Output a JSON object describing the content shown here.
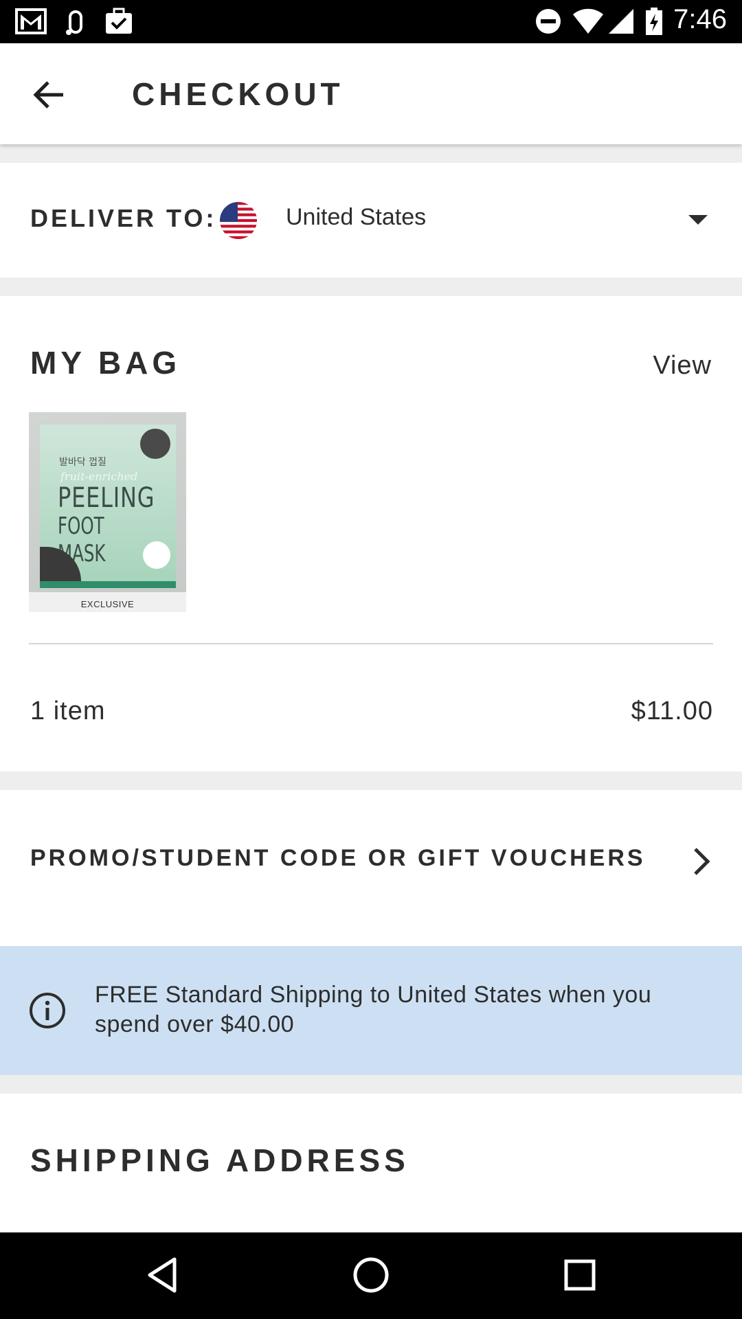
{
  "status_bar": {
    "time": "7:46",
    "left_icons": [
      "gmail-icon",
      "link-icon",
      "briefcase-check-icon"
    ],
    "right_icons": [
      "do-not-disturb-icon",
      "wifi-icon",
      "signal-icon",
      "battery-charging-icon"
    ]
  },
  "app_bar": {
    "title": "CHECKOUT",
    "back_icon": "arrow-back-icon"
  },
  "deliver_to": {
    "label": "DELIVER TO:",
    "country": "United States",
    "flag_icon": "us-flag-icon",
    "dropdown_icon": "caret-down-icon"
  },
  "bag": {
    "title": "MY BAG",
    "view_label": "View",
    "product": {
      "badge": "EXCLUSIVE",
      "packaging_line1": "PEELING",
      "packaging_line2": "FOOT MASK",
      "packaging_script": "fruit-enriched",
      "packaging_korean": "발바닥 껍질"
    },
    "item_count": "1 item",
    "total": "$11.00"
  },
  "promo": {
    "label": "PROMO/STUDENT CODE OR GIFT VOUCHERS",
    "chevron_icon": "chevron-right-icon"
  },
  "info_banner": {
    "icon": "info-icon",
    "text": "FREE Standard Shipping to United States when you spend over $40.00"
  },
  "shipping": {
    "title": "SHIPPING ADDRESS"
  },
  "nav_bar": {
    "icons": [
      "back-triangle-icon",
      "home-circle-icon",
      "recents-square-icon"
    ]
  },
  "colors": {
    "text": "#2d2d2d",
    "page_background": "#eeeeee",
    "info_banner": "#cde0f3",
    "bars": "#000000"
  }
}
